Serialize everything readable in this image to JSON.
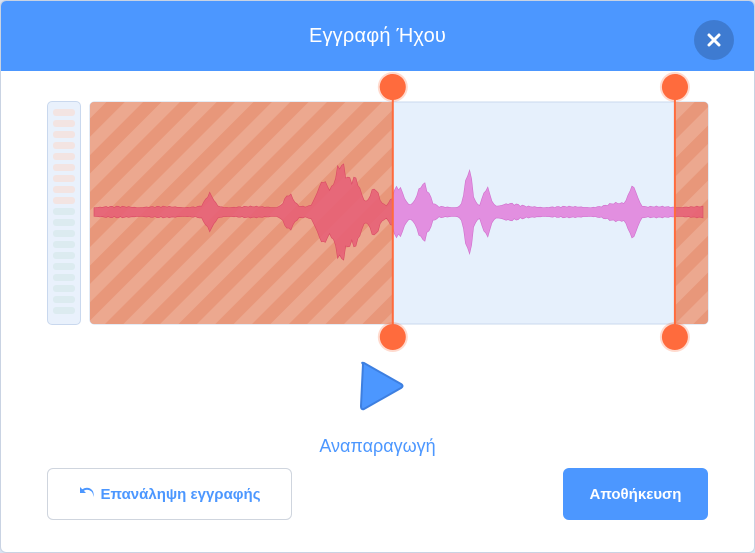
{
  "dialog": {
    "title": "Εγγραφή Ήχου"
  },
  "playback": {
    "label": "Αναπαραγωγή"
  },
  "buttons": {
    "rerecord_label": "Επανάληψη εγγραφής",
    "save_label": "Αποθήκευση"
  },
  "trim": {
    "start_fraction": 0.49,
    "end_fraction": 0.945
  },
  "colors": {
    "header": "#4c97ff",
    "accent": "#4c97ff",
    "trim_handle": "#ff6b3d",
    "trimmed_fill": "#e8977a",
    "waveform": "#e28fe0",
    "waveform_trimmed": "#e65d75",
    "selection_bg": "#e6f0fc"
  },
  "icons": {
    "close": "close-icon",
    "play": "play-icon",
    "rerecord": "undo-arrow-icon"
  }
}
